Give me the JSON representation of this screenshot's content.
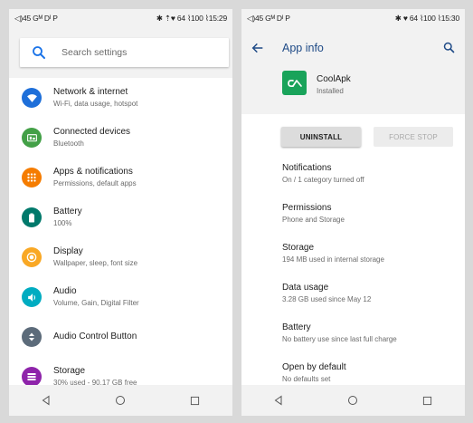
{
  "left_phone": {
    "status": {
      "left": "◁)45 Gᴹ Dᴵ P",
      "right": "✱ ⇡♥ 64 ⌇100 ⌇15:29"
    },
    "search": {
      "placeholder": "Search settings"
    },
    "items": [
      {
        "title": "Network & internet",
        "sub": "Wi-Fi, data usage, hotspot",
        "icon": "wifi-icon",
        "color": "#1e6fd9"
      },
      {
        "title": "Connected devices",
        "sub": "Bluetooth",
        "icon": "devices-icon",
        "color": "#43a047"
      },
      {
        "title": "Apps & notifications",
        "sub": "Permissions, default apps",
        "icon": "apps-icon",
        "color": "#f57c00"
      },
      {
        "title": "Battery",
        "sub": "100%",
        "icon": "battery-icon",
        "color": "#00796b"
      },
      {
        "title": "Display",
        "sub": "Wallpaper, sleep, font size",
        "icon": "brightness-icon",
        "color": "#f9a825"
      },
      {
        "title": "Audio",
        "sub": "Volume, Gain, Digital Filter",
        "icon": "volume-icon",
        "color": "#00acc1"
      },
      {
        "title": "Audio Control Button",
        "sub": "",
        "icon": "control-icon",
        "color": "#5c6b7a"
      },
      {
        "title": "Storage",
        "sub": "30% used - 90.17 GB free",
        "icon": "storage-icon",
        "color": "#8e24aa"
      }
    ]
  },
  "right_phone": {
    "status": {
      "left": "◁)45 Gᴹ Dᴵ P",
      "right": "✱ ♥ 64 ⌇100 ⌇15:30"
    },
    "appbar": {
      "title": "App info"
    },
    "app": {
      "name": "CoolApk",
      "state": "Installed"
    },
    "buttons": {
      "uninstall": "UNINSTALL",
      "force_stop": "FORCE STOP"
    },
    "items": [
      {
        "title": "Notifications",
        "sub": "On / 1 category turned off"
      },
      {
        "title": "Permissions",
        "sub": "Phone and Storage"
      },
      {
        "title": "Storage",
        "sub": "194 MB used in internal storage"
      },
      {
        "title": "Data usage",
        "sub": "3.28 GB used since May 12"
      },
      {
        "title": "Battery",
        "sub": "No battery use since last full charge"
      },
      {
        "title": "Open by default",
        "sub": "No defaults set"
      }
    ]
  }
}
